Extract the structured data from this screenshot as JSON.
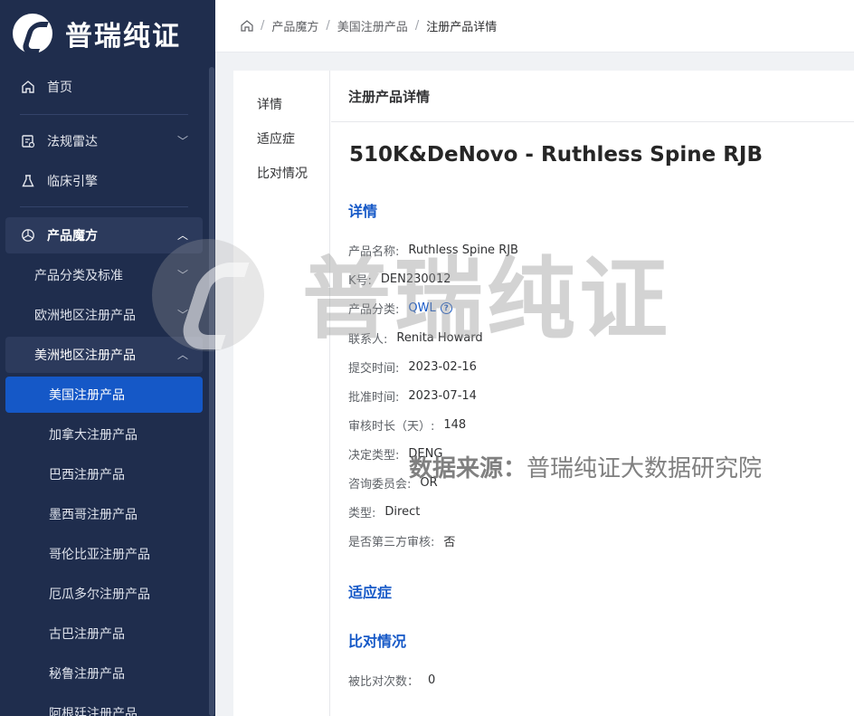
{
  "brand": {
    "name": "普瑞纯证"
  },
  "sidebar": {
    "items": [
      {
        "label": "首页",
        "icon": "home-icon"
      },
      {
        "label": "法规雷达",
        "icon": "radar-icon"
      },
      {
        "label": "临床引擎",
        "icon": "flask-icon"
      },
      {
        "label": "产品魔方",
        "icon": "cube-icon"
      }
    ],
    "sub_items": [
      {
        "label": "产品分类及标准"
      },
      {
        "label": "欧洲地区注册产品"
      },
      {
        "label": "美洲地区注册产品"
      }
    ],
    "america_items": [
      {
        "label": "美国注册产品"
      },
      {
        "label": "加拿大注册产品"
      },
      {
        "label": "巴西注册产品"
      },
      {
        "label": "墨西哥注册产品"
      },
      {
        "label": "哥伦比亚注册产品"
      },
      {
        "label": "厄瓜多尔注册产品"
      },
      {
        "label": "古巴注册产品"
      },
      {
        "label": "秘鲁注册产品"
      },
      {
        "label": "阿根廷注册产品"
      }
    ]
  },
  "breadcrumb": {
    "items": [
      "产品魔方",
      "美国注册产品",
      "注册产品详情"
    ]
  },
  "anchor_nav": {
    "items": [
      "详情",
      "适应症",
      "比对情况"
    ]
  },
  "card": {
    "title": "注册产品详情"
  },
  "product": {
    "title": "510K&DeNovo - Ruthless Spine RJB"
  },
  "sections": {
    "detail": "详情",
    "indication": "适应症",
    "comparison": "比对情况"
  },
  "details": {
    "name": {
      "label": "产品名称:",
      "value": "Ruthless Spine RJB"
    },
    "k_number": {
      "label": "K号:",
      "value": "DEN230012"
    },
    "category": {
      "label": "产品分类:",
      "value": "QWL"
    },
    "contact": {
      "label": "联系人:",
      "value": "Renita Howard"
    },
    "submit_date": {
      "label": "提交时间:",
      "value": "2023-02-16"
    },
    "approve_date": {
      "label": "批准时间:",
      "value": "2023-07-14"
    },
    "review_days": {
      "label": "审核时长（天）:",
      "value": "148"
    },
    "decision_type": {
      "label": "决定类型:",
      "value": "DENG"
    },
    "committee": {
      "label": "咨询委员会:",
      "value": "OR"
    },
    "type": {
      "label": "类型:",
      "value": "Direct"
    },
    "third_party": {
      "label": "是否第三方审核:",
      "value": "否"
    }
  },
  "comparison": {
    "label": "被比对次数：",
    "value": "0"
  },
  "watermark": {
    "text": "普瑞纯证",
    "source_label": "数据来源：",
    "source_value": "普瑞纯证大数据研究院"
  },
  "colors": {
    "sidebar_bg": "#1f2d4d",
    "active": "#1558c7",
    "accent_text": "#1558c7"
  }
}
